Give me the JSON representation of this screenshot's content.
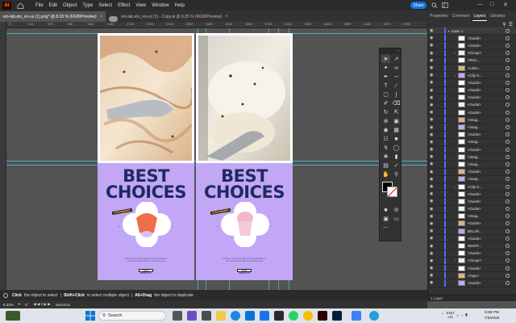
{
  "menubar": {
    "app_logo": "Ai",
    "items": [
      "File",
      "Edit",
      "Object",
      "Type",
      "Select",
      "Effect",
      "View",
      "Window",
      "Help"
    ],
    "share_label": "Share"
  },
  "tabs": [
    {
      "label": "elo-lab.elo_en-us (1).png* @ 8.33 % (RGB/Preview)",
      "active": true
    },
    {
      "label": "elo-lab.elo_en-us (1) - Copy.ai @ 6.25 % (RGB/Preview)",
      "active": false
    }
  ],
  "panel_tabs": [
    "Properties",
    "Comment",
    "Layers",
    "Libraries"
  ],
  "ruler_ticks": [
    "72",
    "144",
    "576",
    "288",
    "1152",
    "1440",
    "1728",
    "2016",
    "2304",
    "2592",
    "2880",
    "3168",
    "3456",
    "3744",
    "4032",
    "4320",
    "4608",
    "4896",
    "5184",
    "5472",
    "5760"
  ],
  "artboards": [
    {
      "headline_1": "BEST",
      "headline_2": "CHOICES",
      "sticker": "STRAWBERRY",
      "arrow_left": "←",
      "arrow_right": "→",
      "cta": "SHOP PRODUCTS",
      "caption_1": "Premium ice cream made with real strawberries",
      "caption_2": "and creamy fresh milk for a delicious treat"
    },
    {
      "headline_1": "BEST",
      "headline_2": "CHOICES",
      "sticker": "STRAWBERRY",
      "arrow_left": "←",
      "arrow_right": "→",
      "cta": "SHOP PRODUCTS",
      "caption_1": "Premium ice cream made with real strawberries",
      "caption_2": "and creamy fresh milk for a delicious treat"
    }
  ],
  "layers": {
    "items": [
      {
        "name": "Layer 1",
        "expander": "▾"
      },
      {
        "name": "<Guide>",
        "expander": ""
      },
      {
        "name": "<Guide>",
        "expander": ""
      },
      {
        "name": "<Group>",
        "expander": "›"
      },
      {
        "name": "<Rect...",
        "expander": ""
      },
      {
        "name": "<Linke...",
        "expander": ""
      },
      {
        "name": "<Clip G...",
        "expander": "›"
      },
      {
        "name": "<Guide>",
        "expander": ""
      },
      {
        "name": "<Guide>",
        "expander": ""
      },
      {
        "name": "<Guide>",
        "expander": ""
      },
      {
        "name": "<Guide>",
        "expander": ""
      },
      {
        "name": "<Guide>",
        "expander": ""
      },
      {
        "name": "<Imag...",
        "expander": ""
      },
      {
        "name": "<Imag...",
        "expander": ""
      },
      {
        "name": "<Guide>",
        "expander": ""
      },
      {
        "name": "<Imag...",
        "expander": ""
      },
      {
        "name": "<Guide>",
        "expander": ""
      },
      {
        "name": "<Imag...",
        "expander": ""
      },
      {
        "name": "<Imag...",
        "expander": ""
      },
      {
        "name": "<Guide>",
        "expander": ""
      },
      {
        "name": "<Imag...",
        "expander": ""
      },
      {
        "name": "<Clip G...",
        "expander": "›"
      },
      {
        "name": "<Guide>",
        "expander": ""
      },
      {
        "name": "<Guide>",
        "expander": ""
      },
      {
        "name": "<Guide>",
        "expander": ""
      },
      {
        "name": "<Imag...",
        "expander": ""
      },
      {
        "name": "<Guide>",
        "expander": ""
      },
      {
        "name": "BELAR...",
        "expander": ""
      },
      {
        "name": "<Guide>",
        "expander": ""
      },
      {
        "name": "WHIPP...",
        "expander": ""
      },
      {
        "name": "<Guide>",
        "expander": ""
      },
      {
        "name": "<Group>",
        "expander": "›"
      },
      {
        "name": "<Guide>",
        "expander": ""
      },
      {
        "name": "<Type>",
        "expander": ""
      },
      {
        "name": "<Guide>",
        "expander": ""
      }
    ],
    "footer": "1 Layer"
  },
  "hint": {
    "k1": "Click",
    "t1": "the object to select",
    "k2": "Shift+Click",
    "t2": "to select multiple object",
    "k3": "Alt+Drag",
    "t3": "the object to duplicate"
  },
  "status": {
    "zoom": "8.33%",
    "angle": "0°",
    "artboard_num": "1",
    "tool": "Selection"
  },
  "taskbar": {
    "search_placeholder": "Search"
  },
  "tray": {
    "lang_1": "ENG",
    "lang_2": "US"
  },
  "clock": {
    "time": "5:58 PM",
    "date": "7/5/2025"
  },
  "colors": {
    "lavender": "#c1a7f5",
    "navy": "#1f2a5e",
    "accent": "#1473e6",
    "guide": "#4ec6d6"
  }
}
